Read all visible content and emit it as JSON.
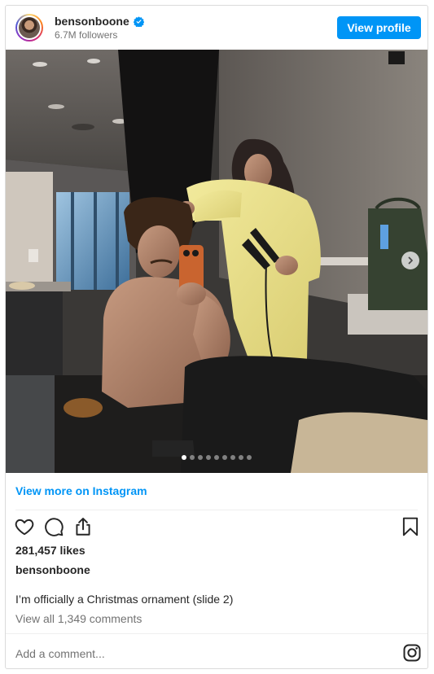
{
  "header": {
    "username": "bensonboone",
    "verified": true,
    "followers": "6.7M followers",
    "view_profile_label": "View profile"
  },
  "media": {
    "slide_count": 9,
    "active_slide": 1,
    "next_icon": "chevron-right-icon"
  },
  "links": {
    "view_more": "View more on Instagram"
  },
  "actions": {
    "like_icon": "heart-icon",
    "comment_icon": "comment-icon",
    "share_icon": "share-icon",
    "save_icon": "bookmark-icon"
  },
  "post": {
    "likes": "281,457 likes",
    "owner": "bensonboone",
    "caption": "I’m officially a Christmas ornament (slide 2)",
    "view_comments": "View all 1,349 comments"
  },
  "comment_box": {
    "placeholder": "Add a comment..."
  },
  "colors": {
    "accent": "#0095f6",
    "text": "#262626",
    "muted": "#737373",
    "border": "#dbdbdb"
  }
}
